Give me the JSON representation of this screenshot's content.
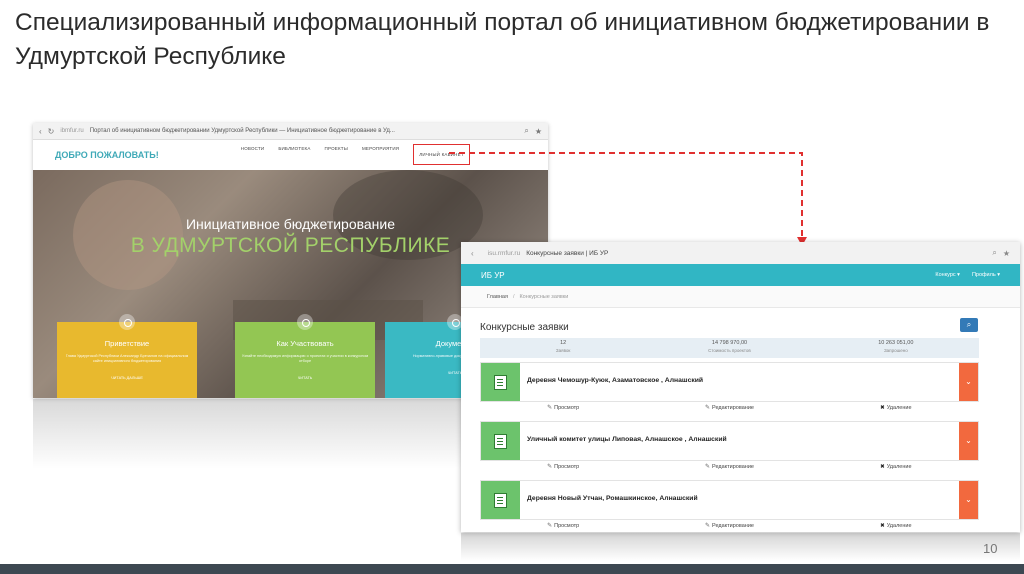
{
  "slide": {
    "title": "Специализированный информационный портал об инициативном бюджетировании в Удмуртской Республике",
    "page_number": "10"
  },
  "left_screenshot": {
    "browser": {
      "address": "ibmfur.ru",
      "tab_title": "Портал об инициативном бюджетировании Удмуртской Республики — Инициативное бюджетирование в Уд..."
    },
    "welcome": "ДОБРО ПОЖАЛОВАТЬ!",
    "menu": [
      "НОВОСТИ",
      "БИБЛИОТЕКА",
      "ПРОЕКТЫ",
      "МЕРОПРИЯТИЯ",
      "ЛИЧНЫЙ КАБИНЕТ"
    ],
    "hero": {
      "line1": "Инициативное бюджетирование",
      "line2": "В УДМУРТСКОЙ РЕСПУБЛИКЕ"
    },
    "cards": [
      {
        "title": "Приветствие",
        "text": "Глава Удмуртской Республики Александр Бречалов на официальном сайте инициативного бюджетирования",
        "more": "ЧИТАТЬ ДАЛЬШЕ"
      },
      {
        "title": "Как Участвовать",
        "text": "Узнайте необходимую информацию о проектах и участии в конкурсном отборе",
        "more": "ЧИТАТЬ"
      },
      {
        "title": "Документы",
        "text": "Нормативно-правовые документы и материалы",
        "more": "ЧИТАТЬ"
      }
    ],
    "accent_colors": {
      "yellow": "#e8b92e",
      "green": "#93c653",
      "teal": "#3ab9c3",
      "highlight_border": "#e03030"
    }
  },
  "right_screenshot": {
    "browser": {
      "address": "isu.rmfur.ru",
      "tab_title": "Конкурсные заявки | ИБ УР"
    },
    "app_name": "ИБ УР",
    "header_menu": [
      "Конкурс ▾",
      "Профиль ▾"
    ],
    "breadcrumb": {
      "home": "Главная",
      "current": "Конкурсные заявки"
    },
    "page_title": "Конкурсные заявки",
    "stats": [
      {
        "value": "12",
        "label": "Заявок"
      },
      {
        "value": "14 798 970,00",
        "label": "Стоимость проектов"
      },
      {
        "value": "10 263 051,00",
        "label": "Запрошено"
      }
    ],
    "applications": [
      {
        "title": "Деревня Чемошур-Куюк, Азаматовское , Алнашский"
      },
      {
        "title": "Уличный комитет улицы Липовая, Алнашское , Алнашский"
      },
      {
        "title": "Деревня Новый Утчан, Ромашкинское, Алнашский"
      }
    ],
    "actions": {
      "view": "Просмотр",
      "edit": "Редактирование",
      "delete": "Удаление"
    },
    "accent_colors": {
      "header": "#31b6c4",
      "doc_icon": "#6cc36c",
      "expand": "#f2693e",
      "search_button": "#337ab7"
    }
  }
}
